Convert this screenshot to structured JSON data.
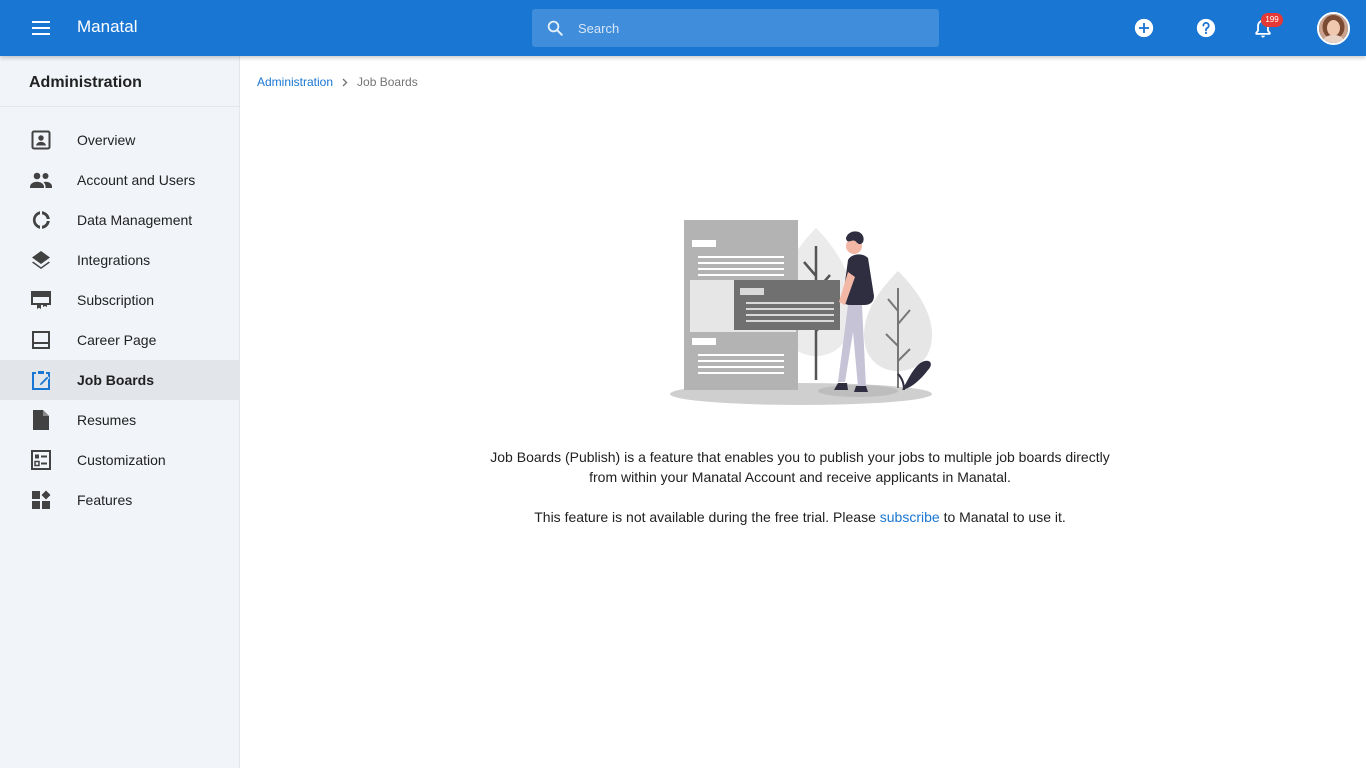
{
  "topbar": {
    "app_name": "Manatal",
    "search_placeholder": "Search",
    "notification_count": "199",
    "accent_color": "#1976d2"
  },
  "sidebar": {
    "title": "Administration",
    "items": [
      {
        "label": "Overview",
        "icon": "account-box-icon"
      },
      {
        "label": "Account and Users",
        "icon": "people-icon"
      },
      {
        "label": "Data Management",
        "icon": "donut-icon"
      },
      {
        "label": "Integrations",
        "icon": "layers-icon"
      },
      {
        "label": "Subscription",
        "icon": "card-icon"
      },
      {
        "label": "Career Page",
        "icon": "web-page-icon"
      },
      {
        "label": "Job Boards",
        "icon": "clipboard-edit-icon",
        "active": true
      },
      {
        "label": "Resumes",
        "icon": "document-icon"
      },
      {
        "label": "Customization",
        "icon": "checklist-icon"
      },
      {
        "label": "Features",
        "icon": "widgets-icon"
      }
    ]
  },
  "breadcrumb": {
    "parent": "Administration",
    "current": "Job Boards"
  },
  "main": {
    "description": "Job Boards (Publish) is a feature that enables you to publish your jobs to multiple job boards directly from within your Manatal Account and receive applicants in Manatal.",
    "notice_before": "This feature is not available during the free trial. Please ",
    "notice_link": "subscribe",
    "notice_after": " to Manatal to use it."
  }
}
